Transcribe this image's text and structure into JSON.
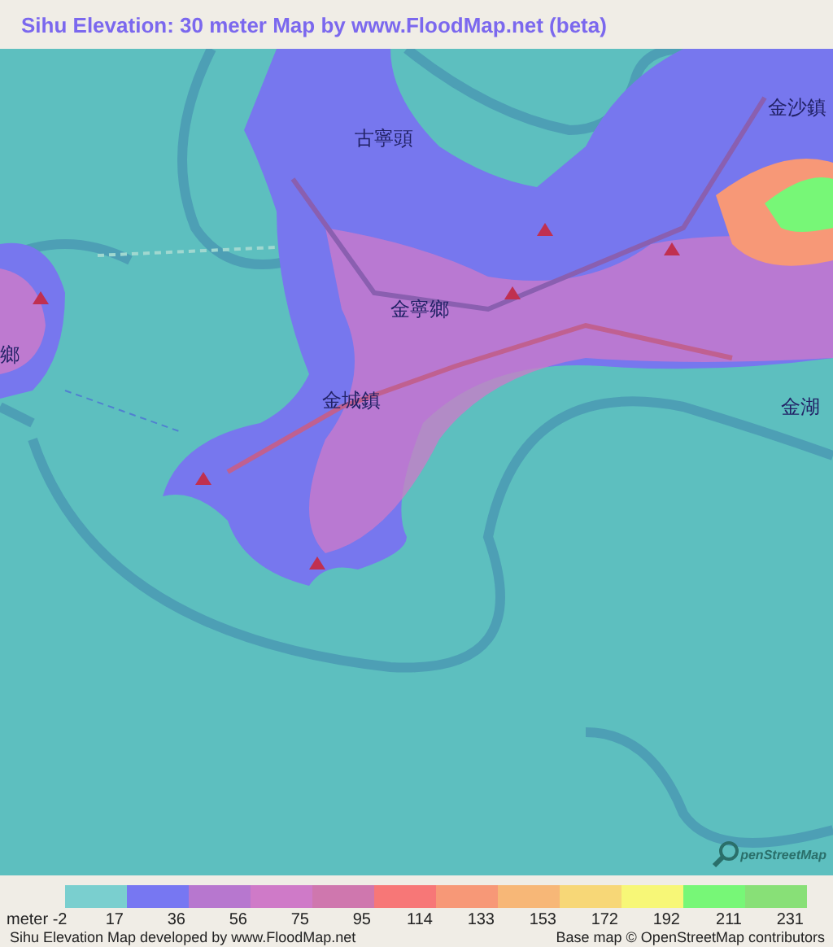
{
  "title": "Sihu Elevation: 30 meter Map by www.FloodMap.net (beta)",
  "map": {
    "place_labels": [
      "古寧頭",
      "金沙鎮",
      "金寧鄉",
      "金城鎮",
      "金湖",
      "鄉"
    ],
    "attribution_logo": "penStreetMap"
  },
  "legend": {
    "unit": "meter -2",
    "swatches": [
      {
        "color": "#7acfcf",
        "label": "17"
      },
      {
        "color": "#7777f2",
        "label": "36"
      },
      {
        "color": "#b777cf",
        "label": "56"
      },
      {
        "color": "#cf7ac8",
        "label": "75"
      },
      {
        "color": "#cf77ae",
        "label": "95"
      },
      {
        "color": "#f77777",
        "label": "114"
      },
      {
        "color": "#f79877",
        "label": "133"
      },
      {
        "color": "#f7b777",
        "label": "153"
      },
      {
        "color": "#f7d777",
        "label": "172"
      },
      {
        "color": "#f7f777",
        "label": "192"
      },
      {
        "color": "#77f777",
        "label": "211"
      },
      {
        "color": "#88e077",
        "label": "231"
      }
    ]
  },
  "footer": {
    "credit": "Sihu Elevation Map developed by www.FloodMap.net",
    "base_map": "Base map © OpenStreetMap contributors"
  }
}
